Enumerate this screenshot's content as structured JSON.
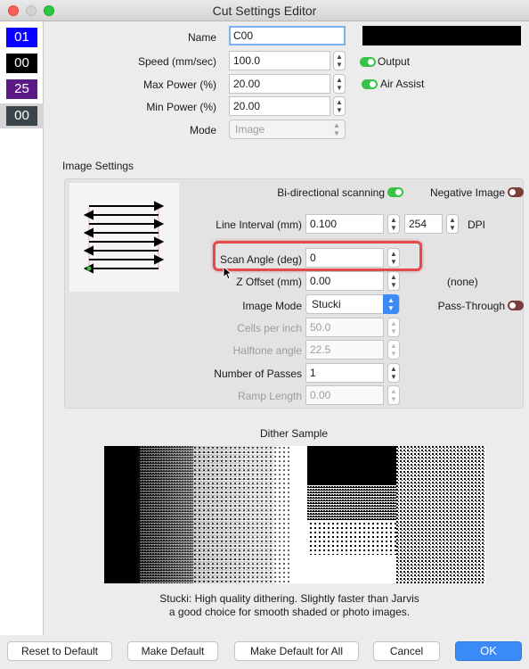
{
  "window": {
    "title": "Cut Settings Editor"
  },
  "layers": [
    {
      "label": "01",
      "color": "#0a00ff"
    },
    {
      "label": "00",
      "color": "#000000"
    },
    {
      "label": "25",
      "color": "#5b1a86"
    },
    {
      "label": "00",
      "color": "#3b4449"
    }
  ],
  "fields": {
    "name_label": "Name",
    "name_value": "C00",
    "speed_label": "Speed (mm/sec)",
    "speed_value": "100.0",
    "max_power_label": "Max Power (%)",
    "max_power_value": "20.00",
    "min_power_label": "Min Power (%)",
    "min_power_value": "20.00",
    "mode_label": "Mode",
    "mode_value": "Image",
    "layer_color": "#000000"
  },
  "toggles": {
    "output": "Output",
    "output_on": true,
    "air_assist": "Air Assist",
    "air_assist_on": true
  },
  "image_settings": {
    "title": "Image Settings",
    "bidirectional_label": "Bi-directional scanning",
    "bidirectional_on": true,
    "negative_label": "Negative Image",
    "negative_on": false,
    "line_interval_label": "Line Interval (mm)",
    "line_interval_value": "0.100",
    "dpi_value": "254",
    "dpi_label": "DPI",
    "scan_angle_label": "Scan Angle (deg)",
    "scan_angle_value": "0",
    "z_offset_label": "Z Offset (mm)",
    "z_offset_value": "0.00",
    "z_offset_note": "(none)",
    "image_mode_label": "Image Mode",
    "image_mode_value": "Stucki",
    "pass_through_label": "Pass-Through",
    "pass_through_on": false,
    "cells_label": "Cells per inch",
    "cells_value": "50.0",
    "halftone_label": "Halftone angle",
    "halftone_value": "22.5",
    "passes_label": "Number of Passes",
    "passes_value": "1",
    "ramp_label": "Ramp Length",
    "ramp_value": "0.00"
  },
  "dither": {
    "title": "Dither Sample",
    "caption_line1": "Stucki: High quality dithering. Slightly faster than Jarvis",
    "caption_line2": "a good choice for smooth shaded or photo images."
  },
  "buttons": {
    "reset": "Reset to Default",
    "make_default": "Make Default",
    "make_default_all": "Make Default for All",
    "cancel": "Cancel",
    "ok": "OK"
  },
  "colors": {
    "accent": "#3a8af7",
    "toggle_on": "#38c247",
    "toggle_off": "#7a3d3a",
    "highlight": "#e34b4b"
  }
}
